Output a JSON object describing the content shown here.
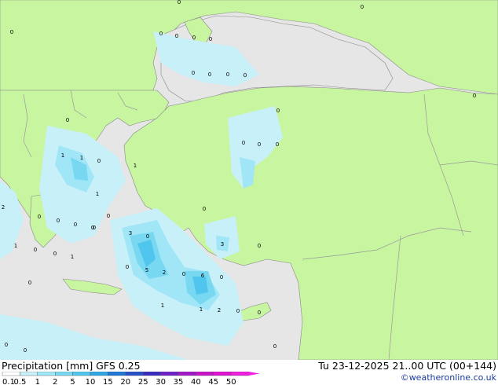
{
  "title_left": "Precipitation [mm]  GFS 0.25",
  "title_right": "Tu 23-12-2025 21..00 UTC (00+144)",
  "credit": "©weatheronline.co.uk",
  "legend": {
    "ticks": [
      "0.1",
      "0.5",
      "1",
      "2",
      "5",
      "10",
      "15",
      "20",
      "25",
      "30",
      "35",
      "40",
      "45",
      "50"
    ],
    "colors": [
      "#ffffff",
      "#c8f0f8",
      "#a0e6f6",
      "#78d8f2",
      "#50c6ee",
      "#2ea8e4",
      "#1e78d6",
      "#2850c8",
      "#3a2cc0",
      "#7020c8",
      "#a018c8",
      "#c814c8",
      "#e014d0",
      "#f020e0"
    ]
  },
  "map_labels": [
    {
      "text": "0"
    },
    {
      "text": "0"
    },
    {
      "text": "0"
    },
    {
      "text": "0"
    },
    {
      "text": "0"
    },
    {
      "text": "0"
    },
    {
      "text": "0"
    },
    {
      "text": "0"
    },
    {
      "text": "0"
    },
    {
      "text": "0"
    },
    {
      "text": "0"
    },
    {
      "text": "0"
    },
    {
      "text": "0"
    },
    {
      "text": "0"
    },
    {
      "text": "0"
    },
    {
      "text": "1"
    },
    {
      "text": "1"
    },
    {
      "text": "0"
    },
    {
      "text": "1"
    },
    {
      "text": "1"
    },
    {
      "text": "0"
    },
    {
      "text": "0"
    },
    {
      "text": "2"
    },
    {
      "text": "0"
    },
    {
      "text": "0"
    },
    {
      "text": "0"
    },
    {
      "text": "0"
    },
    {
      "text": "1"
    },
    {
      "text": "0"
    },
    {
      "text": "1"
    },
    {
      "text": "0"
    },
    {
      "text": "3"
    },
    {
      "text": "0"
    },
    {
      "text": "0"
    },
    {
      "text": "0"
    },
    {
      "text": "3"
    },
    {
      "text": "0"
    },
    {
      "text": "5"
    },
    {
      "text": "2"
    },
    {
      "text": "0"
    },
    {
      "text": "6"
    },
    {
      "text": "0"
    },
    {
      "text": "0"
    },
    {
      "text": "1"
    },
    {
      "text": "1"
    },
    {
      "text": "2"
    },
    {
      "text": "0"
    },
    {
      "text": "0"
    },
    {
      "text": "0"
    },
    {
      "text": "0"
    },
    {
      "text": "0"
    },
    {
      "text": "0"
    },
    {
      "text": "0"
    }
  ],
  "colors": {
    "land": "#c8f5a0",
    "sea": "#e6e6e6",
    "border": "#9a9a9a"
  }
}
